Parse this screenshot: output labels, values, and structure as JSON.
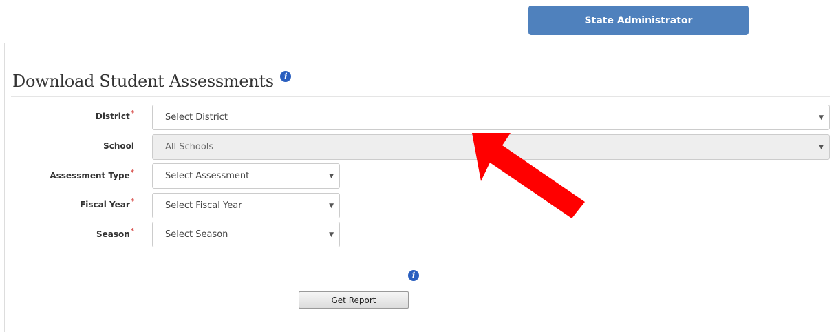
{
  "header": {
    "role_button_label": "State Administrator"
  },
  "page": {
    "title": "Download Student Assessments",
    "title_info_icon": "i",
    "required_marker": "*"
  },
  "form": {
    "district": {
      "label": "District",
      "value": "Select District",
      "required": true
    },
    "school": {
      "label": "School",
      "value": "All Schools",
      "required": false,
      "disabled": true
    },
    "assessment_type": {
      "label": "Assessment Type",
      "value": "Select Assessment",
      "required": true
    },
    "fiscal_year": {
      "label": "Fiscal Year",
      "value": "Select Fiscal Year",
      "required": true
    },
    "season": {
      "label": "Season",
      "value": "Select Season",
      "required": true
    }
  },
  "actions": {
    "info_icon": "i",
    "get_report_label": "Get Report"
  },
  "colors": {
    "role_button_bg": "#4f81bd",
    "required": "#d9534f",
    "info_icon": "#2a5fbf",
    "annotation_arrow": "#ff0000"
  },
  "icons": {
    "title_info": "info-circle-icon",
    "report_info": "info-circle-icon",
    "dropdown_caret": "caret-down-icon",
    "annotation": "red-arrow-annotation"
  }
}
